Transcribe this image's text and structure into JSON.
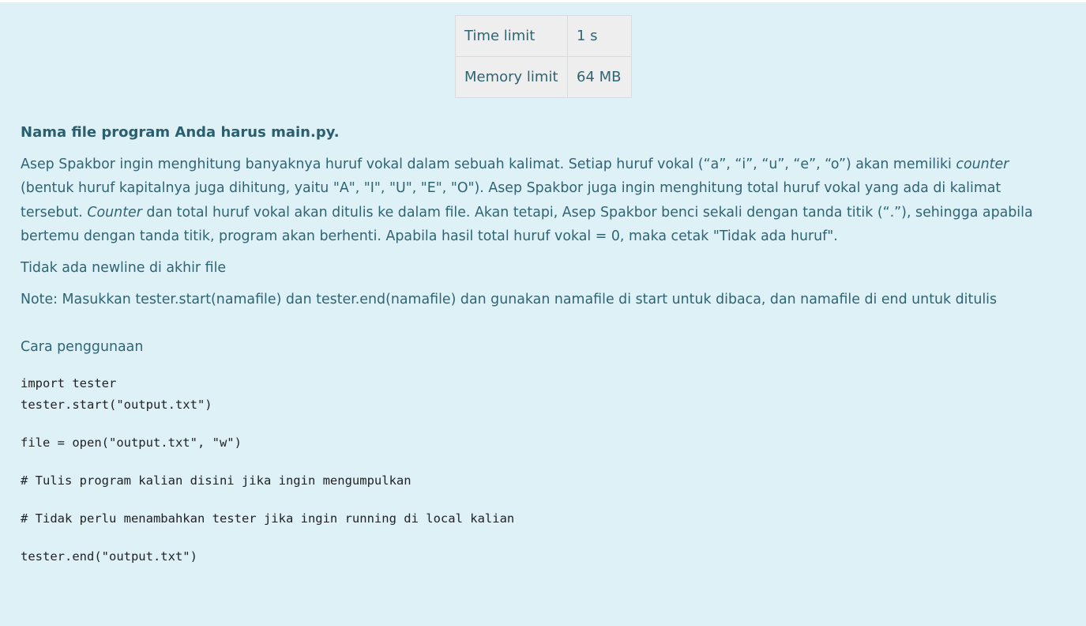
{
  "limits": {
    "time_label": "Time limit",
    "time_value": "1 s",
    "memory_label": "Memory limit",
    "memory_value": "64 MB"
  },
  "statement": {
    "file_note": "Nama file program Anda harus main.py.",
    "desc_1": "Asep Spakbor ingin menghitung banyaknya huruf vokal dalam sebuah kalimat. Setiap huruf vokal (“a”, “i”, “u”, “e”, “o”) akan memiliki ",
    "desc_counter_1": "counter",
    "desc_2": " (bentuk huruf kapitalnya juga dihitung, yaitu \"A\", \"I\", \"U\", \"E\", \"O\"). Asep Spakbor juga ingin menghitung total huruf vokal yang ada di kalimat tersebut. ",
    "desc_counter_2": "Counter",
    "desc_3": " dan total huruf vokal akan ditulis ke dalam file. Akan tetapi, Asep Spakbor benci sekali dengan tanda titik (“.”), sehingga apabila bertemu dengan tanda titik, program akan berhenti. Apabila hasil total huruf vokal = 0, maka cetak \"Tidak ada huruf\".",
    "newline_note": "Tidak ada newline di akhir file",
    "note": "Note: Masukkan tester.start(namafile) dan tester.end(namafile) dan gunakan namafile di start untuk dibaca, dan namafile di end untuk ditulis",
    "usage_heading": "Cara penggunaan"
  },
  "code": {
    "line_1": "import tester",
    "line_2": "tester.start(\"output.txt\")",
    "line_3": "file = open(\"output.txt\", \"w\")",
    "line_4": "# Tulis program kalian disini jika ingin mengumpulkan",
    "line_5": "# Tidak perlu menambahkan tester jika ingin running di local kalian",
    "line_6": "tester.end(\"output.txt\")"
  }
}
